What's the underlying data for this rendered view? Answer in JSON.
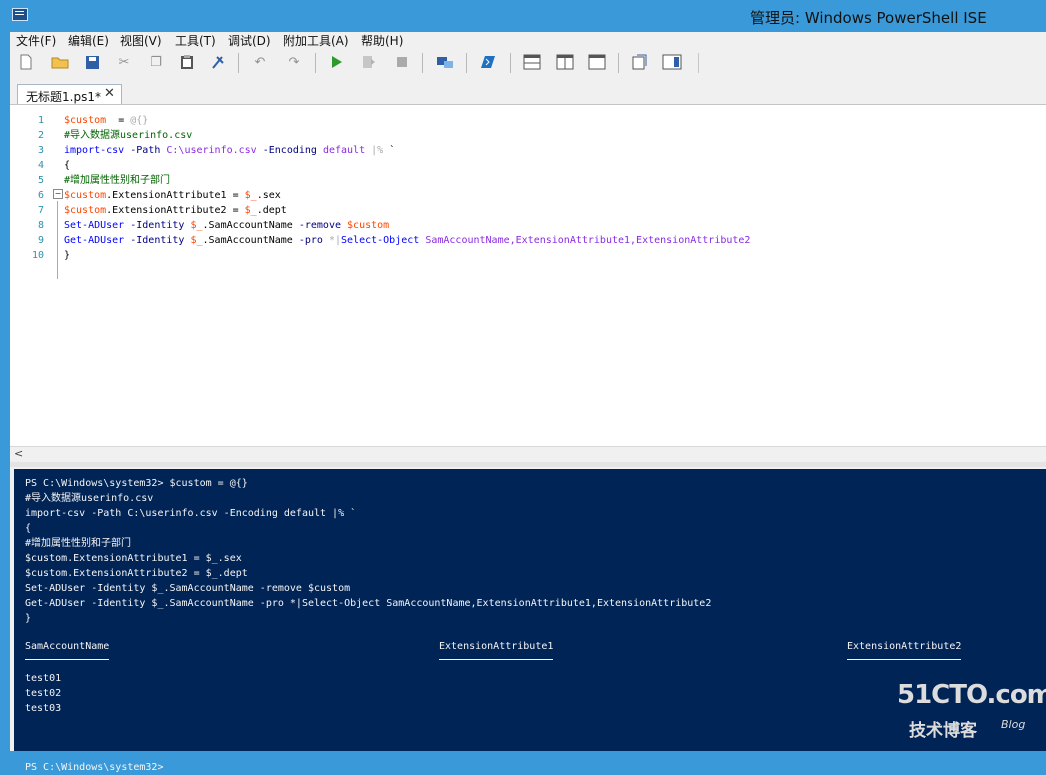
{
  "window": {
    "title": "管理员: Windows PowerShell ISE"
  },
  "menu": [
    "文件(F)",
    "编辑(E)",
    "视图(V)",
    "工具(T)",
    "调试(D)",
    "附加工具(A)",
    "帮助(H)"
  ],
  "toolbar_icons": [
    "new-file-icon",
    "open-folder-icon",
    "save-icon",
    "cut-icon",
    "copy-icon",
    "paste-icon",
    "clear-icon",
    "undo-icon",
    "redo-icon",
    "run-icon",
    "run-selection-icon",
    "stop-icon",
    "remote-tab-icon",
    "powershell-icon",
    "script-pane-top-icon",
    "script-pane-right-icon",
    "script-pane-max-icon",
    "show-script-pane-icon",
    "show-commands-icon"
  ],
  "tab": {
    "label": "无标题1.ps1*",
    "close": "✕"
  },
  "editor": {
    "lines": [
      [
        "1",
        [
          [
            "var",
            "$custom"
          ],
          [
            "",
            "  = "
          ],
          [
            "op",
            "@{}"
          ]
        ]
      ],
      [
        "2",
        [
          [
            "cmt",
            "#导入数据源userinfo.csv"
          ]
        ]
      ],
      [
        "3",
        [
          [
            "cmd",
            "import-csv"
          ],
          [
            "",
            " "
          ],
          [
            "prm",
            "-Path"
          ],
          [
            "",
            " "
          ],
          [
            "arg",
            "C:\\userinfo.csv"
          ],
          [
            "",
            " "
          ],
          [
            "prm",
            "-Encoding"
          ],
          [
            "",
            " "
          ],
          [
            "arg",
            "default"
          ],
          [
            "",
            " "
          ],
          [
            "op",
            "|%"
          ],
          [
            "",
            " `"
          ]
        ]
      ],
      [
        "4",
        [
          [
            "",
            "{"
          ]
        ]
      ],
      [
        "5",
        [
          [
            "cmt",
            "#增加属性性别和子部门"
          ]
        ]
      ],
      [
        "6",
        [
          [
            "var",
            "$custom"
          ],
          [
            "",
            ".ExtensionAttribute1 = "
          ],
          [
            "var",
            "$_"
          ],
          [
            "",
            ".sex"
          ]
        ]
      ],
      [
        "7",
        [
          [
            "var",
            "$custom"
          ],
          [
            "",
            ".ExtensionAttribute2 = "
          ],
          [
            "var",
            "$_"
          ],
          [
            "",
            ".dept"
          ]
        ]
      ],
      [
        "8",
        [
          [
            "cmd",
            "Set-ADUser"
          ],
          [
            "",
            " "
          ],
          [
            "prm",
            "-Identity"
          ],
          [
            "",
            " "
          ],
          [
            "var",
            "$_"
          ],
          [
            "",
            ".SamAccountName "
          ],
          [
            "prm",
            "-remove"
          ],
          [
            "",
            " "
          ],
          [
            "var",
            "$custom"
          ]
        ]
      ],
      [
        "9",
        [
          [
            "cmd",
            "Get-ADUser"
          ],
          [
            "",
            " "
          ],
          [
            "prm",
            "-Identity"
          ],
          [
            "",
            " "
          ],
          [
            "var",
            "$_"
          ],
          [
            "",
            ".SamAccountName "
          ],
          [
            "prm",
            "-pro"
          ],
          [
            "",
            " "
          ],
          [
            "op",
            "*|"
          ],
          [
            "cmd",
            "Select-Object"
          ],
          [
            "",
            " "
          ],
          [
            "arg",
            "SamAccountName,ExtensionAttribute1,ExtensionAttribute2"
          ]
        ]
      ],
      [
        "10",
        [
          [
            "",
            "}"
          ]
        ]
      ]
    ]
  },
  "console": {
    "lines": [
      "PS C:\\Windows\\system32> $custom = @{}",
      "#导入数据源userinfo.csv",
      "import-csv -Path C:\\userinfo.csv -Encoding default |% `",
      "{",
      "#增加属性性别和子部门",
      "$custom.ExtensionAttribute1 = $_.sex",
      "$custom.ExtensionAttribute2 = $_.dept",
      "Set-ADUser -Identity $_.SamAccountName -remove $custom",
      "Get-ADUser -Identity $_.SamAccountName -pro *|Select-Object SamAccountName,ExtensionAttribute1,ExtensionAttribute2",
      "}"
    ],
    "columns": [
      "SamAccountName",
      "ExtensionAttribute1",
      "ExtensionAttribute2"
    ],
    "rows": [
      "test01",
      "test02",
      "test03"
    ],
    "prompt": "PS C:\\Windows\\system32>"
  },
  "watermark": {
    "site": "51CTO.com",
    "sub": "技术博客",
    "blog": "Blog"
  }
}
